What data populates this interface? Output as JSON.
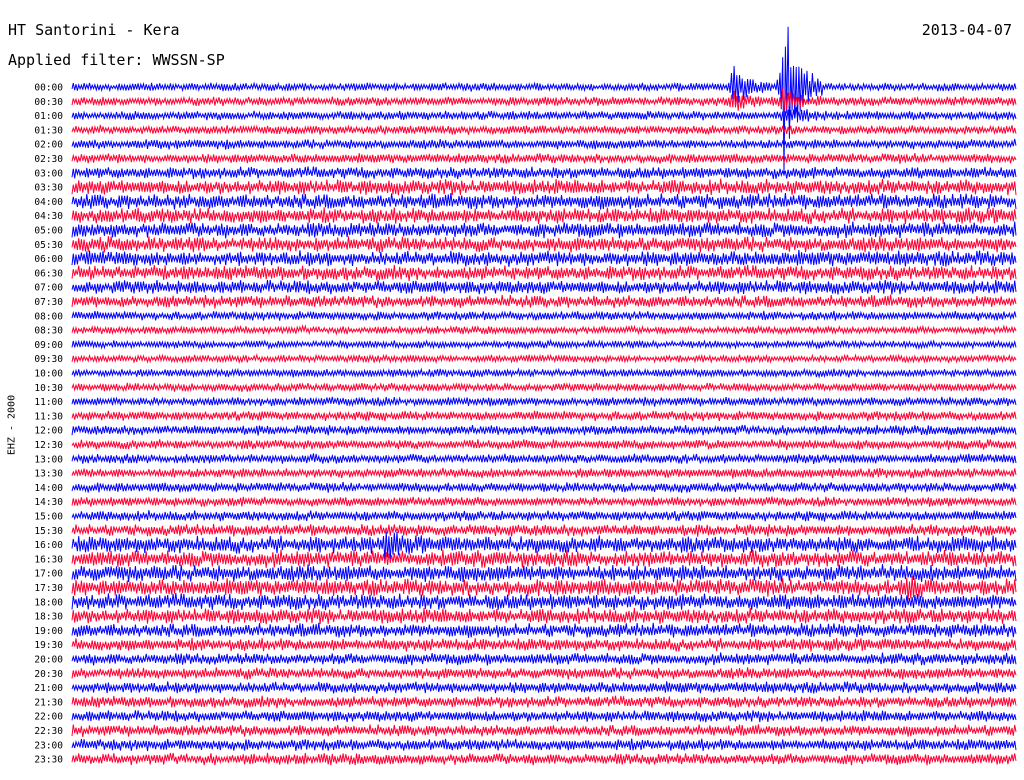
{
  "header": {
    "station": "HT Santorini - Kera",
    "filter": "Applied filter: WWSSN-SP",
    "date": "2013-04-07",
    "channel": "EHZ - 2000"
  },
  "colors": {
    "even_trace": "#0000ff",
    "odd_trace": "#ff0033",
    "background": "#ffffff"
  },
  "chart_data": {
    "type": "line",
    "title": "HT Santorini - Kera",
    "subtitle": "Applied filter: WWSSN-SP",
    "ylabel": "EHZ - 2000",
    "x_unit": "minutes",
    "xlim": [
      0,
      30
    ],
    "trace_colors": [
      "#0000ff",
      "#ff0033"
    ],
    "categories": [
      "00:00",
      "00:30",
      "01:00",
      "01:30",
      "02:00",
      "02:30",
      "03:00",
      "03:30",
      "04:00",
      "04:30",
      "05:00",
      "05:30",
      "06:00",
      "06:30",
      "07:00",
      "07:30",
      "08:00",
      "08:30",
      "09:00",
      "09:30",
      "10:00",
      "10:30",
      "11:00",
      "11:30",
      "12:00",
      "12:30",
      "13:00",
      "13:30",
      "14:00",
      "14:30",
      "15:00",
      "15:30",
      "16:00",
      "16:30",
      "17:00",
      "17:30",
      "18:00",
      "18:30",
      "19:00",
      "19:30",
      "20:00",
      "20:30",
      "21:00",
      "21:30",
      "22:00",
      "22:30",
      "23:00",
      "23:30"
    ],
    "noise_level": [
      0.4,
      0.5,
      0.5,
      0.5,
      0.6,
      0.6,
      0.9,
      1.4,
      1.4,
      1.4,
      1.4,
      1.4,
      1.4,
      1.3,
      1.2,
      1.0,
      0.5,
      0.3,
      0.3,
      0.3,
      0.35,
      0.4,
      0.5,
      0.6,
      0.6,
      0.6,
      0.6,
      0.6,
      0.6,
      0.6,
      0.7,
      0.9,
      1.6,
      1.6,
      1.6,
      1.6,
      1.5,
      1.4,
      1.2,
      1.0,
      0.9,
      0.85,
      0.85,
      0.85,
      0.85,
      0.85,
      0.85,
      0.85
    ],
    "events": [
      {
        "row": 0,
        "minute": 22.6,
        "amplitude": 90
      },
      {
        "row": 0,
        "minute": 21.0,
        "amplitude": 22
      },
      {
        "row": 1,
        "minute": 22.6,
        "amplitude": 14
      },
      {
        "row": 1,
        "minute": 21.0,
        "amplitude": 8
      },
      {
        "row": 2,
        "minute": 22.7,
        "amplitude": 10
      },
      {
        "row": 32,
        "minute": 9.9,
        "amplitude": 10
      },
      {
        "row": 35,
        "minute": 26.5,
        "amplitude": 8
      }
    ]
  }
}
